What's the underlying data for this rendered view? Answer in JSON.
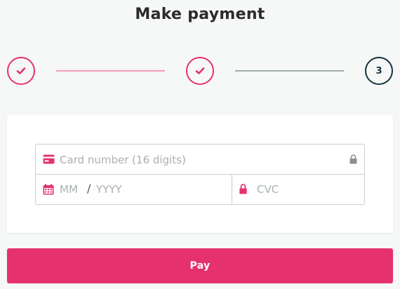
{
  "header": {
    "title": "Make payment"
  },
  "stepper": {
    "steps": [
      {
        "state": "completed",
        "icon": "checkmark-icon"
      },
      {
        "state": "completed",
        "icon": "checkmark-icon"
      },
      {
        "state": "current",
        "label": "3"
      }
    ]
  },
  "card_form": {
    "card_number": {
      "placeholder": "Card number (16 digits)",
      "value": "",
      "icon": "credit-card-icon",
      "trailing_icon": "lock-icon"
    },
    "expiry_month": {
      "placeholder": "MM",
      "value": "",
      "icon": "calendar-icon"
    },
    "expiry_separator": "/",
    "expiry_year": {
      "placeholder": "YYYY",
      "value": ""
    },
    "cvc": {
      "placeholder": "CVC",
      "value": "",
      "icon": "lock-icon"
    }
  },
  "pay_button": {
    "label": "Pay"
  },
  "colors": {
    "accent": "#e5326f",
    "step_current": "#13333d",
    "line_done": "#f29bbd",
    "line_todo": "#9fb0b0",
    "background": "#f6f7f7"
  }
}
